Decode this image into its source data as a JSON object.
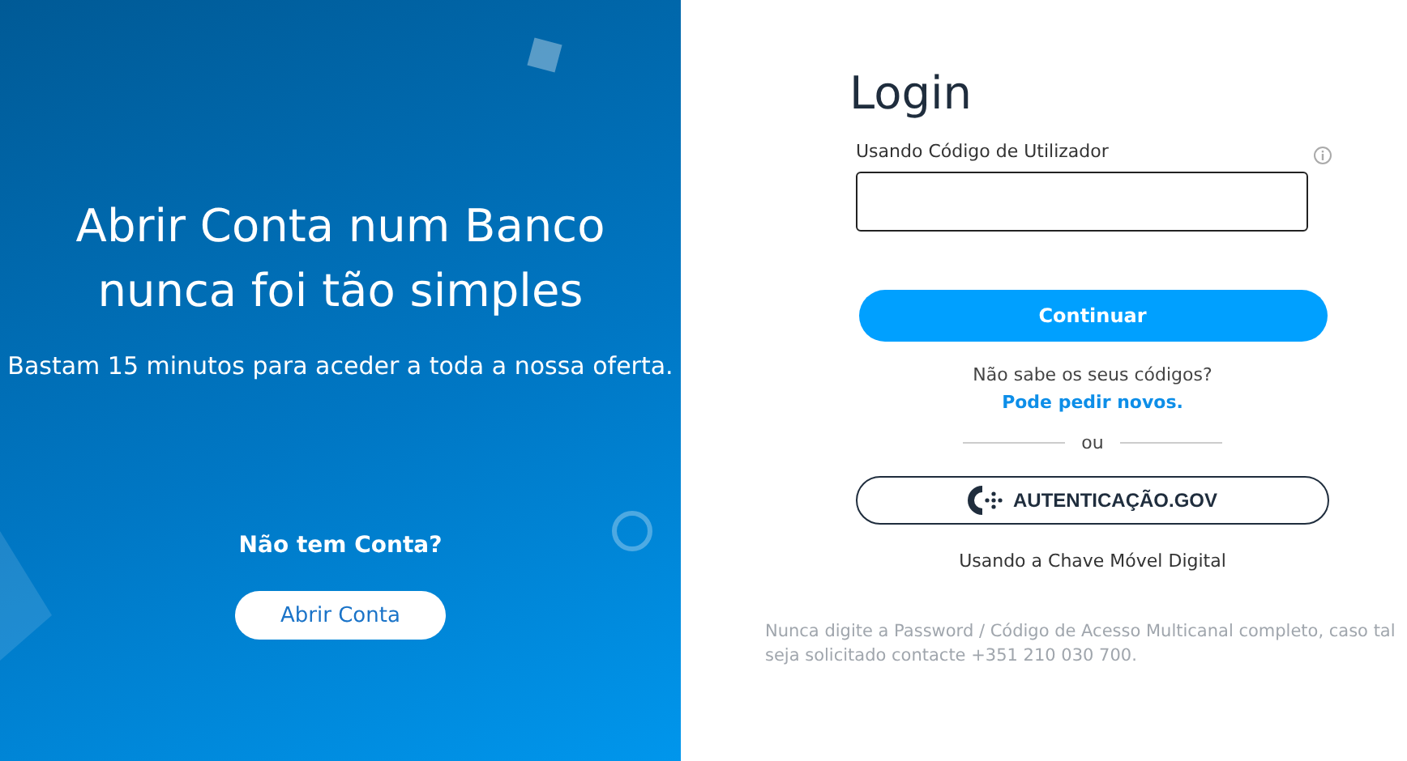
{
  "promo": {
    "headline": [
      "Abrir Conta num Banco",
      "nunca foi tão simples"
    ],
    "subtitle": "Bastam 15 minutos para aceder a toda a nossa oferta.",
    "question": "Não tem Conta?",
    "button": "Abrir Conta"
  },
  "login": {
    "title": "Login",
    "field_label": "Usando Código de Utilizador",
    "continue_button": "Continuar",
    "help_text": "Não sabe os seus códigos?",
    "help_link": "Pode pedir novos.",
    "divider": "ou",
    "gov_button": "AUTENTICAÇÃO.GOV",
    "gov_caption": "Usando a Chave Móvel Digital",
    "footer": "Nunca digite a Password / Código de Acesso Multicanal completo, caso tal seja solicitado contacte +351 210 030 700."
  }
}
